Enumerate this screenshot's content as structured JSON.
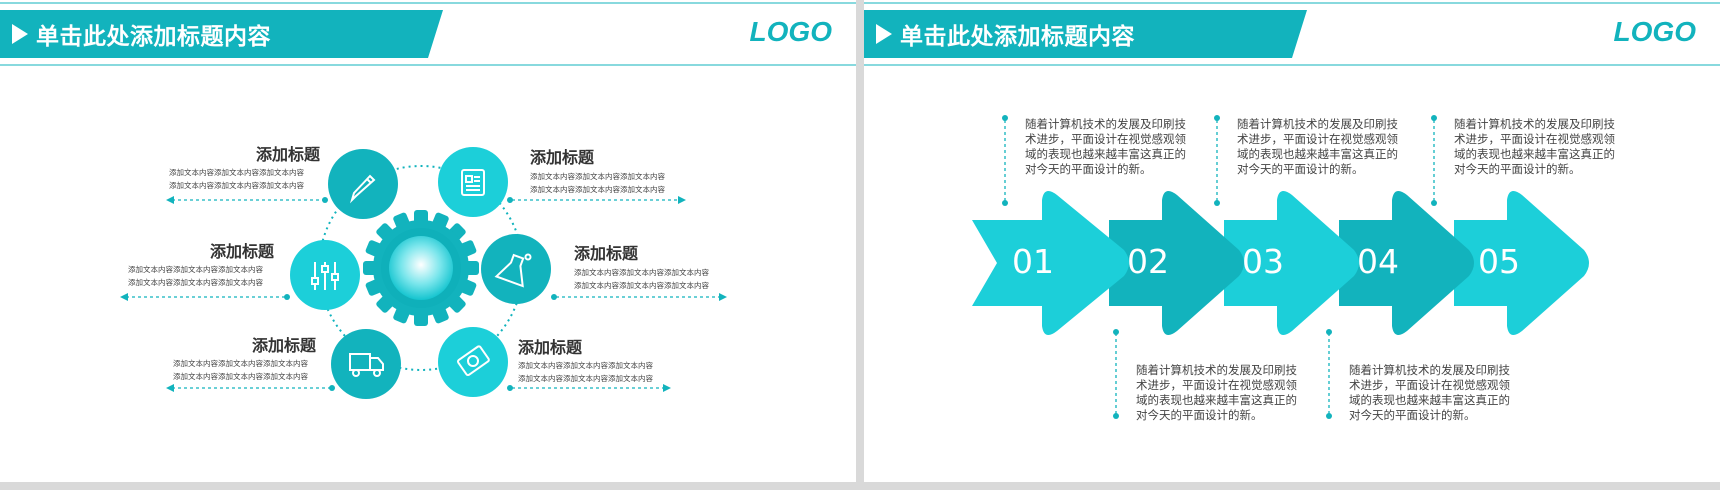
{
  "slides": [
    {
      "title": "单击此处添加标题内容",
      "logo": "LOGO",
      "items": [
        {
          "title": "添加标题",
          "text": [
            "添加文本内容添加文本内容添加文本内容",
            "添加文本内容添加文本内容添加文本内容"
          ],
          "icon": "pencil-icon"
        },
        {
          "title": "添加标题",
          "text": [
            "添加文本内容添加文本内容添加文本内容",
            "添加文本内容添加文本内容添加文本内容"
          ],
          "icon": "document-icon"
        },
        {
          "title": "添加标题",
          "text": [
            "添加文本内容添加文本内容添加文本内容",
            "添加文本内容添加文本内容添加文本内容"
          ],
          "icon": "sliders-icon"
        },
        {
          "title": "添加标题",
          "text": [
            "添加文本内容添加文本内容添加文本内容",
            "添加文本内容添加文本内容添加文本内容"
          ],
          "icon": "flask-icon"
        },
        {
          "title": "添加标题",
          "text": [
            "添加文本内容添加文本内容添加文本内容",
            "添加文本内容添加文本内容添加文本内容"
          ],
          "icon": "truck-icon"
        },
        {
          "title": "添加标题",
          "text": [
            "添加文本内容添加文本内容添加文本内容",
            "添加文本内容添加文本内容添加文本内容"
          ],
          "icon": "money-icon"
        }
      ]
    },
    {
      "title": "单击此处添加标题内容",
      "logo": "LOGO",
      "steps": [
        "01",
        "02",
        "03",
        "04",
        "05"
      ],
      "paragraphs": [
        "随着计算机技术的发展及印刷技术进步，平面设计在视觉感观领域的表现也越来越丰富这真正的对今天的平面设计的新。",
        "随着计算机技术的发展及印刷技术进步，平面设计在视觉感观领域的表现也越来越丰富这真正的对今天的平面设计的新。",
        "随着计算机技术的发展及印刷技术进步，平面设计在视觉感观领域的表现也越来越丰富这真正的对今天的平面设计的新。",
        "随着计算机技术的发展及印刷技术进步，平面设计在视觉感观领域的表现也越来越丰富这真正的对今天的平面设计的新。",
        "随着计算机技术的发展及印刷技术进步，平面设计在视觉感观领域的表现也越来越丰富这真正的对今天的平面设计的新。"
      ]
    }
  ],
  "colors": {
    "accent": "#12b3bd",
    "accent_light": "#1ccfd9",
    "accent_dark": "#0f9aa3",
    "text": "#333333"
  }
}
